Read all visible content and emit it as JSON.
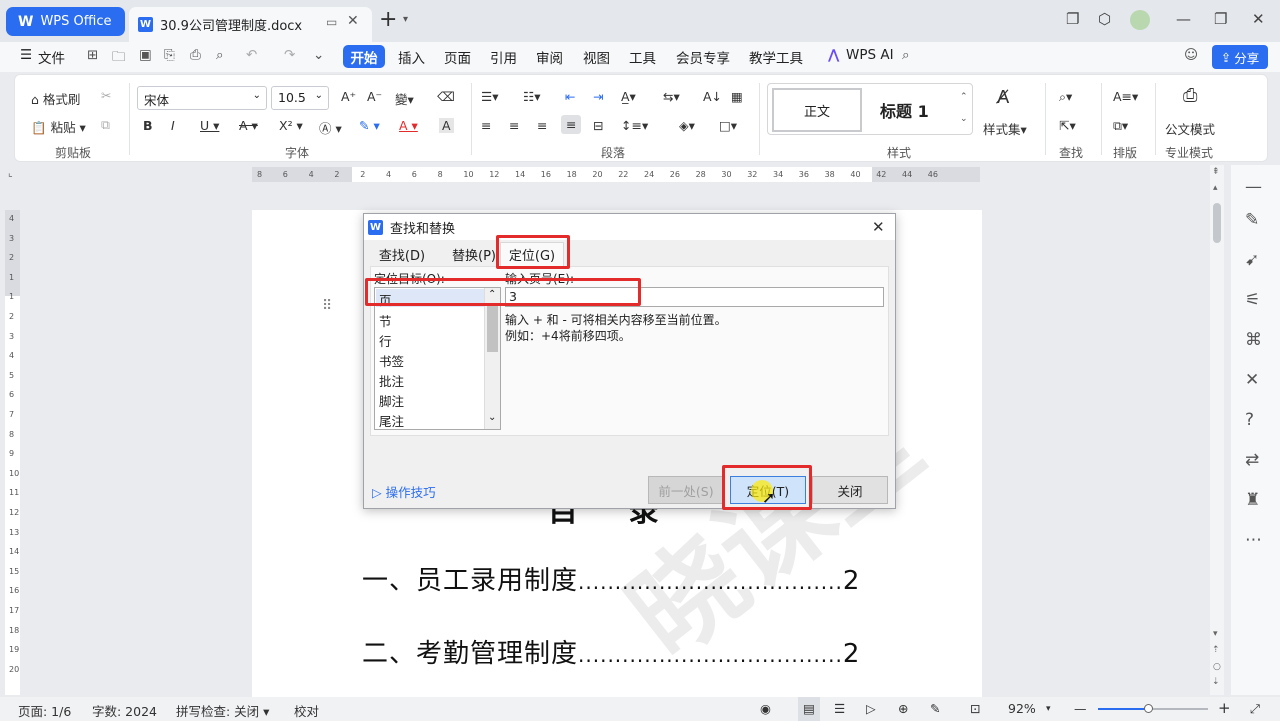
{
  "titlebar": {
    "app_tab": "WPS Office",
    "doc_tab": "30.9公司管理制度.docx",
    "new_tab": "+"
  },
  "menubar": {
    "file": "文件",
    "items": [
      "开始",
      "插入",
      "页面",
      "引用",
      "审阅",
      "视图",
      "工具",
      "会员专享",
      "教学工具"
    ],
    "wps_ai": "WPS AI",
    "share": "分享"
  },
  "ribbon": {
    "clipboard": {
      "format_painter": "格式刷",
      "paste": "粘贴",
      "group": "剪贴板"
    },
    "font": {
      "name": "宋体",
      "size": "10.5",
      "group": "字体"
    },
    "paragraph": {
      "group": "段落"
    },
    "styles": {
      "normal": "正文",
      "heading1": "标题 1",
      "style_set": "样式集",
      "group": "样式"
    },
    "find": {
      "group": "查找"
    },
    "layout": {
      "group": "排版"
    },
    "pro": {
      "official_doc": "公文模式",
      "group": "专业模式"
    }
  },
  "ruler": {
    "h_ticks": [
      "8",
      "6",
      "4",
      "2",
      "2",
      "4",
      "6",
      "8",
      "10",
      "12",
      "14",
      "16",
      "18",
      "20",
      "22",
      "24",
      "26",
      "28",
      "30",
      "32",
      "34",
      "36",
      "38",
      "40",
      "42",
      "44",
      "46"
    ],
    "v_ticks": [
      "4",
      "3",
      "2",
      "1",
      "1",
      "2",
      "3",
      "4",
      "5",
      "6",
      "7",
      "8",
      "9",
      "10",
      "11",
      "12",
      "13",
      "14",
      "15",
      "16",
      "17",
      "18",
      "19",
      "20"
    ]
  },
  "document": {
    "toc": [
      {
        "title": "一、员工录用制度",
        "leader": "....................................",
        "page": "2"
      },
      {
        "title": "二、考勤管理制度",
        "leader": "....................................",
        "page": "2"
      }
    ],
    "heading_fragment": "目   录",
    "watermark": "晓课堂"
  },
  "dialog": {
    "title": "查找和替换",
    "tabs": [
      "查找(D)",
      "替换(P)",
      "定位(G)"
    ],
    "target_label": "定位目标(O):",
    "page_label": "输入页号(E):",
    "targets": [
      "页",
      "节",
      "行",
      "书签",
      "批注",
      "脚注",
      "尾注"
    ],
    "page_value": "3",
    "hint1": "输入 + 和 - 可将相关内容移至当前位置。",
    "hint2": "例如：+4将前移四项。",
    "tips": "操作技巧",
    "prev": "前一处(S)",
    "goto": "定位(T)",
    "close": "关闭"
  },
  "statusbar": {
    "page": "页面: 1/6",
    "words": "字数: 2024",
    "spell": "拼写检查: 关闭",
    "proof": "校对",
    "zoom": "92%"
  },
  "colors": {
    "accent": "#2b6df0",
    "highlight": "#e32b2b"
  }
}
